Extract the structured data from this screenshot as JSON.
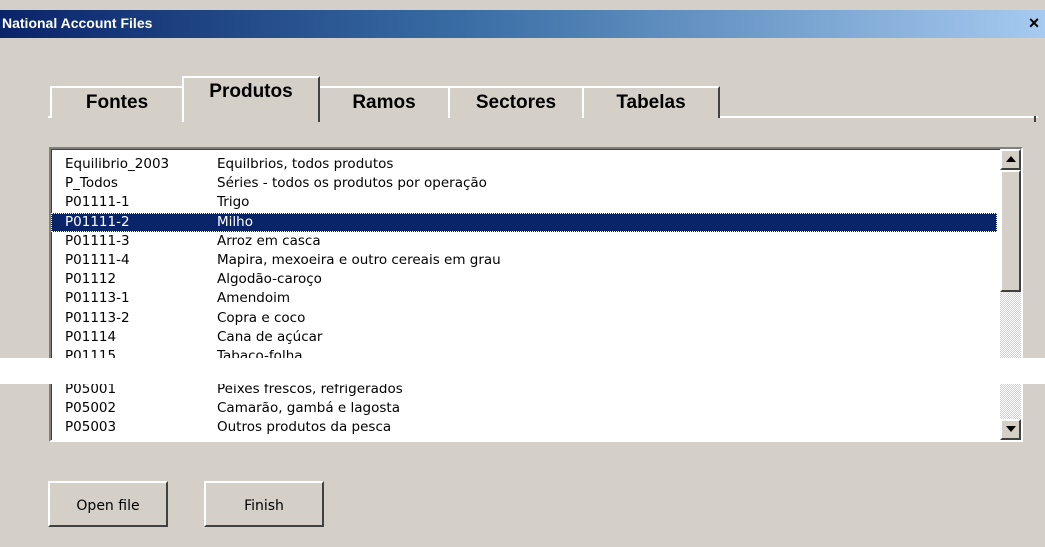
{
  "window": {
    "title": "National Account Files",
    "close_glyph": "×"
  },
  "tabs": [
    {
      "label": "Fontes",
      "active": false
    },
    {
      "label": "Produtos",
      "active": true
    },
    {
      "label": "Ramos",
      "active": false
    },
    {
      "label": "Sectores",
      "active": false
    },
    {
      "label": "Tabelas",
      "active": false
    }
  ],
  "list": {
    "items": [
      {
        "code": "Equilibrio_2003",
        "desc": "Equilbrios, todos produtos",
        "selected": false
      },
      {
        "code": "P_Todos",
        "desc": "Séries - todos os produtos por operação",
        "selected": false
      },
      {
        "code": "P01111-1",
        "desc": "Trigo",
        "selected": false
      },
      {
        "code": "P01111-2",
        "desc": "Milho",
        "selected": true
      },
      {
        "code": "P01111-3",
        "desc": "Arroz em casca",
        "selected": false
      },
      {
        "code": "P01111-4",
        "desc": "Mapira, mexoeira e outro cereais em grau",
        "selected": false
      },
      {
        "code": "P01112",
        "desc": "Algodão-caroço",
        "selected": false
      },
      {
        "code": "P01113-1",
        "desc": "Amendoim",
        "selected": false
      },
      {
        "code": "P01113-2",
        "desc": "Copra e coco",
        "selected": false
      },
      {
        "code": "P01114",
        "desc": "Cana de açúcar",
        "selected": false
      },
      {
        "code": "P01115",
        "desc": "Tabaco-folha",
        "selected": false
      }
    ],
    "items_after_gap": [
      {
        "code": "P05001",
        "desc": "Peixes frescos, refrigerados"
      },
      {
        "code": "P05002",
        "desc": "Camarão, gambá e lagosta"
      },
      {
        "code": "P05003",
        "desc": "Outros produtos da pesca"
      }
    ]
  },
  "buttons": {
    "open_label": "Open file",
    "finish_label": "Finish"
  },
  "colors": {
    "face": "#d4d0c8",
    "selection": "#0a246a",
    "title_start": "#0a246a"
  },
  "icons": {
    "close": "close-icon",
    "scroll_up": "arrow-up-icon",
    "scroll_down": "arrow-down-icon"
  }
}
